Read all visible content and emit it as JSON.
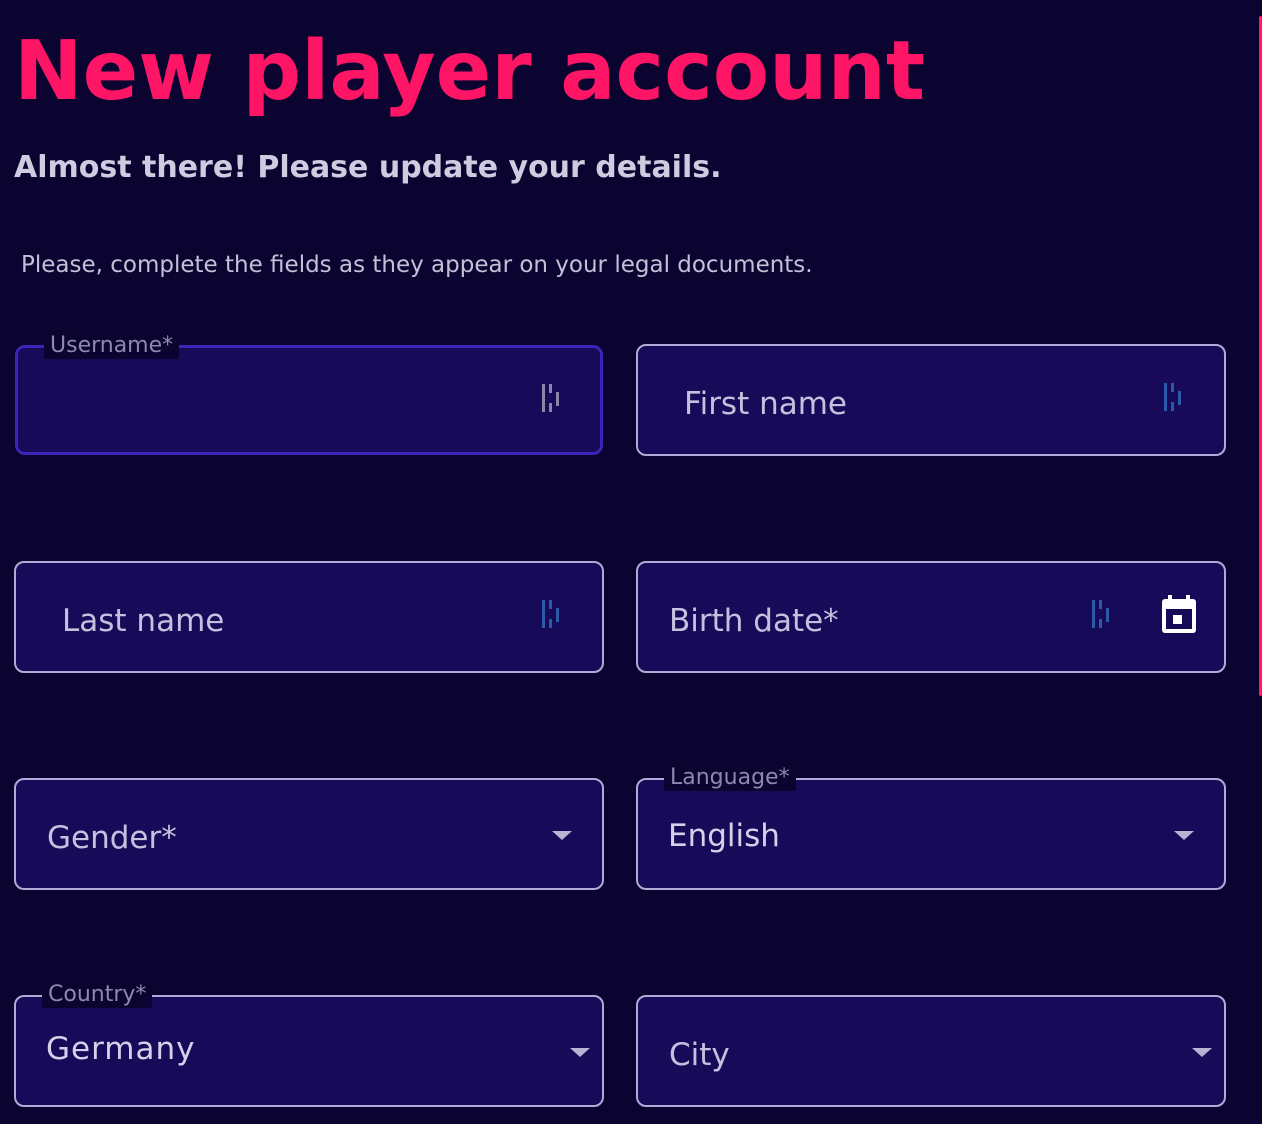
{
  "header": {
    "title": "New player account",
    "subtitle": "Almost there! Please update your details.",
    "instruction": "Please, complete the fields as they appear on your legal documents."
  },
  "form": {
    "username": {
      "label": "Username*",
      "value": ""
    },
    "first_name": {
      "placeholder": "First name"
    },
    "last_name": {
      "placeholder": "Last name"
    },
    "birth_date": {
      "placeholder": "Birth date*"
    },
    "gender": {
      "placeholder": "Gender*"
    },
    "language": {
      "label": "Language*",
      "value": "English"
    },
    "country": {
      "label": "Country*",
      "value": "Germany"
    },
    "city": {
      "placeholder": "City"
    }
  },
  "icons": {
    "password_manager": "password-manager-icon",
    "calendar": "calendar-icon",
    "dropdown": "chevron-down-icon"
  },
  "colors": {
    "background": "#0b0430",
    "field_background": "#170a58",
    "title": "#ff1566",
    "field_border": "#b4a9d6",
    "focused_border": "#3a25b8"
  }
}
